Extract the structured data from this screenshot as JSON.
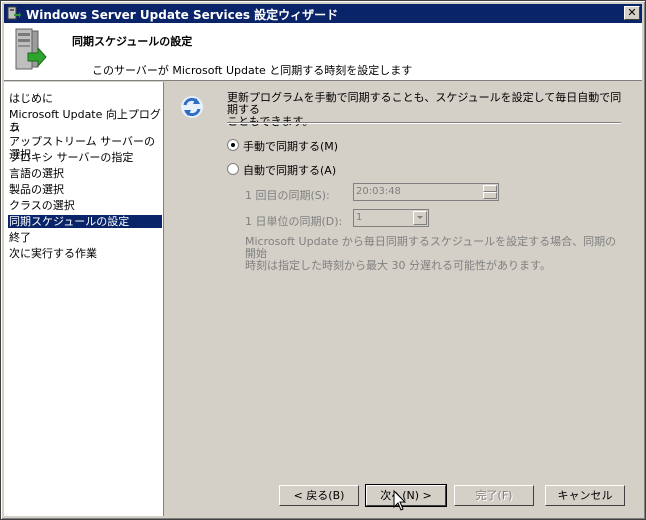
{
  "window": {
    "title": "Windows Server Update Services 設定ウィザード"
  },
  "header": {
    "title": "同期スケジュールの設定",
    "subtitle": "このサーバーが Microsoft Update と同期する時刻を設定します"
  },
  "sidebar": {
    "items": [
      {
        "label": "はじめに"
      },
      {
        "label": "Microsoft Update 向上プログラ"
      },
      {
        "label": "ム"
      },
      {
        "label": "アップストリーム サーバーの選択"
      },
      {
        "label": "プロキシ サーバーの指定"
      },
      {
        "label": "言語の選択"
      },
      {
        "label": "製品の選択"
      },
      {
        "label": "クラスの選択"
      },
      {
        "label": "同期スケジュールの設定"
      },
      {
        "label": "終了"
      },
      {
        "label": "次に実行する作業"
      }
    ],
    "active_index": 8
  },
  "content": {
    "intro_line1": "更新プログラムを手動で同期することも、スケジュールを設定して毎日自動で同期する",
    "intro_line2": "こともできます。",
    "manual_label": "手動で同期する(M)",
    "auto_label": "自動で同期する(A)",
    "selected": "manual",
    "first_sync_label": "1 回目の同期(S):",
    "first_sync_value": "20:03:48",
    "daily_label": "1 日単位の同期(D):",
    "daily_value": "1",
    "note_line1": "Microsoft Update から毎日同期するスケジュールを設定する場合、同期の開始",
    "note_line2": "時刻は指定した時刻から最大 30 分遅れる可能性があります。"
  },
  "buttons": {
    "back": "< 戻る(B)",
    "next": "次へ(N) >",
    "finish": "完了(F)",
    "cancel": "キャンセル"
  },
  "colors": {
    "titlebar": "#0a246a",
    "selection": "#0a246a",
    "face": "#d4d0c8"
  }
}
